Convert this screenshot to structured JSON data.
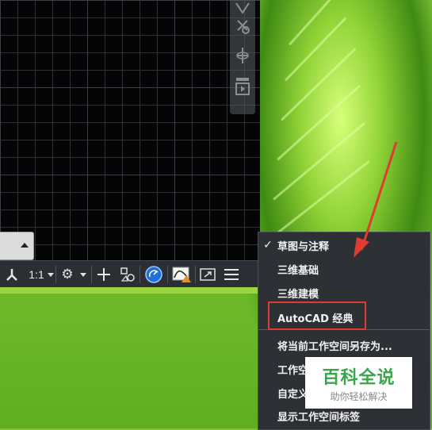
{
  "statusbar": {
    "scale": "1:1",
    "icons": [
      "annotation-scale-icon",
      "gear-icon",
      "plus-icon",
      "isolate-objects-icon",
      "hardware-accel-icon",
      "graphics-performance-icon",
      "fullscreen-icon",
      "hamburger-menu-icon"
    ]
  },
  "workspace_menu": {
    "items": [
      {
        "label": "草图与注释",
        "checked": true
      },
      {
        "label": "三维基础",
        "checked": false
      },
      {
        "label": "三维建模",
        "checked": false
      },
      {
        "label": "AutoCAD 经典",
        "checked": false
      },
      {
        "label": "将当前工作空间另存为...",
        "checked": false
      },
      {
        "label": "工作空",
        "checked": false
      },
      {
        "label": "自定义",
        "checked": false
      },
      {
        "label": "显示工作空间标签",
        "checked": false
      }
    ],
    "check_mark": "✓"
  },
  "watermark": {
    "title": "百科全说",
    "subtitle": "助你轻松解决"
  },
  "colors": {
    "highlight": "#e03b30",
    "accent_blue": "#1e6fd8",
    "watermark_green": "#3aa54a"
  }
}
